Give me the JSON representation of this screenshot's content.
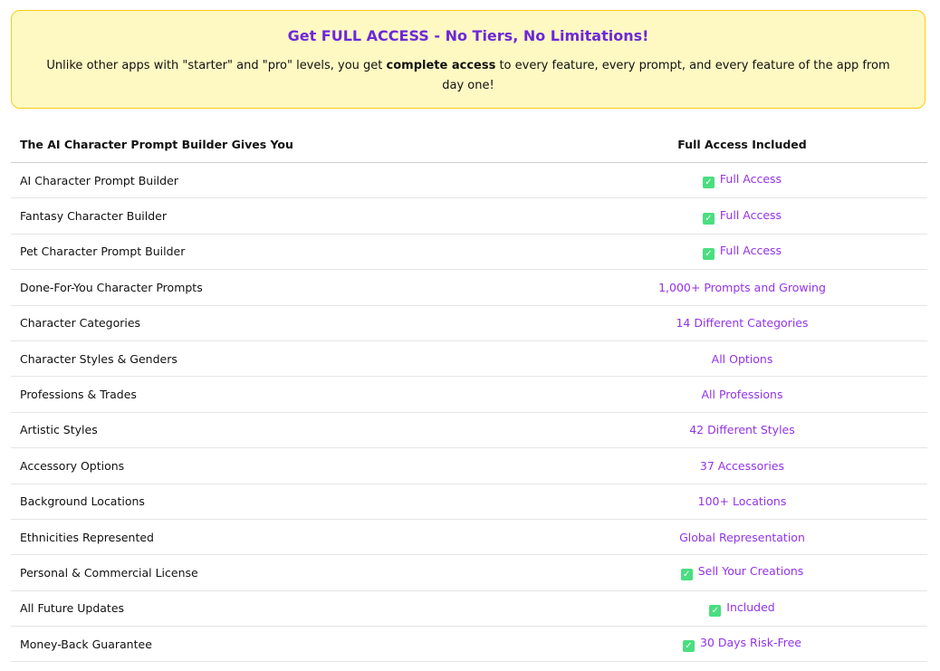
{
  "banner": {
    "title": "Get FULL ACCESS - No Tiers, No Limitations!",
    "body_pre": "Unlike other apps with \"starter\" and \"pro\" levels, you get ",
    "body_bold": "complete access",
    "body_post": " to every feature, every prompt, and every feature of the app from day one!"
  },
  "table": {
    "header_feature": "The AI Character Prompt Builder Gives You",
    "header_access": "Full Access Included",
    "rows": [
      {
        "feature": "AI Character Prompt Builder",
        "access": "Full Access",
        "check": true
      },
      {
        "feature": "Fantasy Character Builder",
        "access": "Full Access",
        "check": true
      },
      {
        "feature": "Pet Character Prompt Builder",
        "access": "Full Access",
        "check": true
      },
      {
        "feature": "Done-For-You Character Prompts",
        "access": "1,000+ Prompts and Growing",
        "check": false
      },
      {
        "feature": "Character Categories",
        "access": "14 Different Categories",
        "check": false
      },
      {
        "feature": "Character Styles & Genders",
        "access": "All Options",
        "check": false
      },
      {
        "feature": "Professions & Trades",
        "access": "All Professions",
        "check": false
      },
      {
        "feature": "Artistic Styles",
        "access": "42 Different Styles",
        "check": false
      },
      {
        "feature": "Accessory Options",
        "access": "37 Accessories",
        "check": false
      },
      {
        "feature": "Background Locations",
        "access": "100+ Locations",
        "check": false
      },
      {
        "feature": "Ethnicities Represented",
        "access": "Global Representation",
        "check": false
      },
      {
        "feature": "Personal & Commercial License",
        "access": "Sell Your Creations",
        "check": true
      },
      {
        "feature": "All Future Updates",
        "access": "Included",
        "check": true
      },
      {
        "feature": "Money-Back Guarantee",
        "access": "30 Days Risk-Free",
        "check": true
      }
    ]
  },
  "icons": {
    "check": "check-mark-icon"
  },
  "colors": {
    "accent": "#9333ea",
    "title": "#6d28d9",
    "check": "#4ade80",
    "banner_bg": "#fef9c3",
    "banner_border": "#facc15"
  }
}
